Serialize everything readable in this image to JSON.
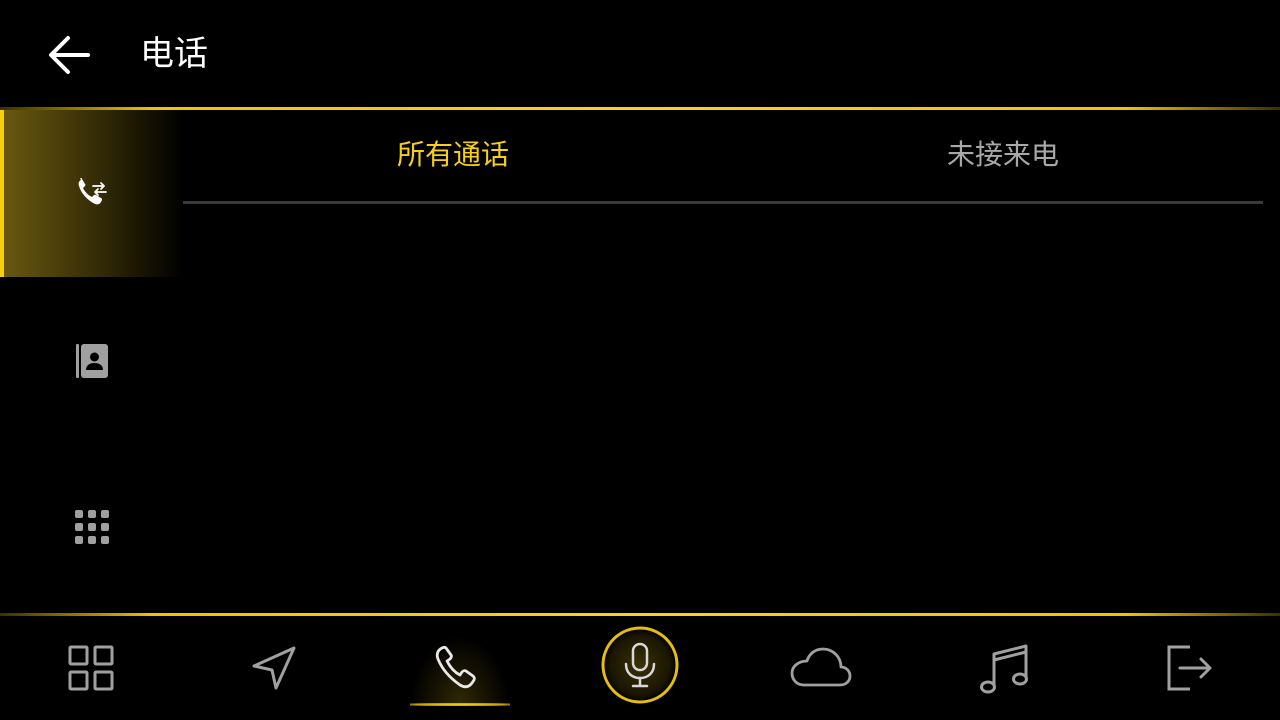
{
  "header": {
    "title": "电话",
    "back_icon": "back-arrow-icon"
  },
  "colors": {
    "accent": "#f5cf1a",
    "inactive_text": "#a8a8a8",
    "icon_gray": "#a0a0a0",
    "background": "#000000"
  },
  "sidebar": {
    "items": [
      {
        "id": "call-log",
        "icon": "call-log-icon",
        "active": true
      },
      {
        "id": "contacts",
        "icon": "contacts-icon",
        "active": false
      },
      {
        "id": "dialpad",
        "icon": "dialpad-icon",
        "active": false
      }
    ]
  },
  "tabs": [
    {
      "label": "所有通话",
      "active": true
    },
    {
      "label": "未接来电",
      "active": false
    }
  ],
  "dock": {
    "items": [
      {
        "icon": "apps-grid-icon",
        "active": false
      },
      {
        "icon": "navigation-icon",
        "active": false
      },
      {
        "icon": "phone-icon",
        "active": true
      },
      {
        "icon": "microphone-icon",
        "active": false
      },
      {
        "icon": "cloud-icon",
        "active": false
      },
      {
        "icon": "music-icon",
        "active": false
      },
      {
        "icon": "exit-icon",
        "active": false
      }
    ]
  }
}
